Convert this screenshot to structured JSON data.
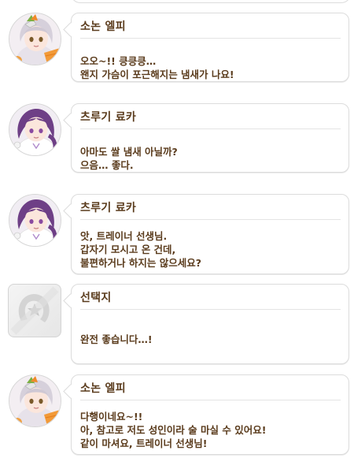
{
  "dialogue": [
    {
      "speaker": "소논 엘피",
      "avatar_icon": "sonon-elfie-portrait-icon",
      "lines": "오오~!! 킁킁킁…\n왠지 가슴이 포근해지는 냄새가 나요!"
    },
    {
      "speaker": "츠루기 료카",
      "avatar_icon": "tsurugi-ryoka-portrait-icon",
      "lines": "아마도 쌀 냄새 아닐까?\n으음… 좋다."
    },
    {
      "speaker": "츠루기 료카",
      "avatar_icon": "tsurugi-ryoka-portrait-icon",
      "lines": "앗, 트레이너 선생님.\n갑자기 모시고 온 건데,\n불편하거나 하지는 않으세요?"
    },
    {
      "speaker": "선택지",
      "avatar_icon": "horseshoe-choice-icon",
      "lines": "완전 좋습니다…!"
    },
    {
      "speaker": "소논 엘피",
      "avatar_icon": "sonon-elfie-portrait-icon",
      "lines": "다행이네요~!!\n아, 참고로 저도 성인이라 술 마실 수 있어요!\n같이 마셔요, 트레이너 선생님!"
    }
  ],
  "colors": {
    "text": "#5a3b1c",
    "border": "#dcdcdc",
    "elfie_hair": "#d9d4dc",
    "ryoka_hair": "#6e3f86"
  }
}
